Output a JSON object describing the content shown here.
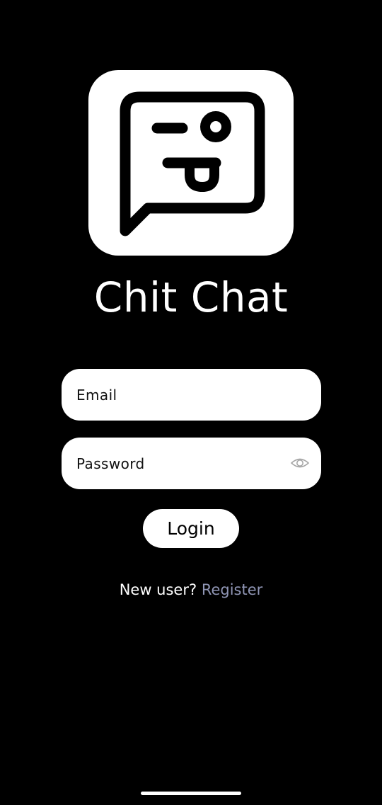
{
  "app": {
    "title": "Chit Chat",
    "logo_icon": "chat-bubble-winking-face-icon"
  },
  "login_form": {
    "email_placeholder": "Email",
    "email_value": "",
    "password_placeholder": "Password",
    "password_value": "",
    "password_toggle_icon": "eye-icon",
    "login_label": "Login"
  },
  "register": {
    "prompt": "New user?",
    "link_label": "Register"
  },
  "colors": {
    "background": "#000000",
    "surface": "#ffffff",
    "link": "#8f95b4"
  }
}
